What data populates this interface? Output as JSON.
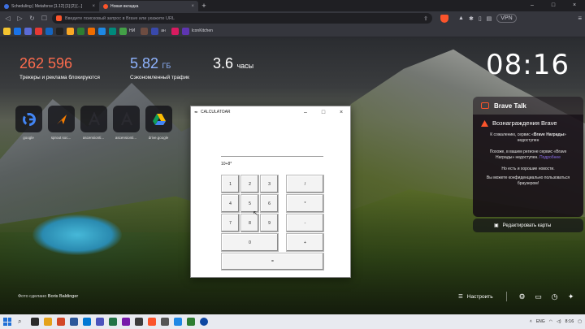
{
  "browser": {
    "tabs": [
      {
        "title": "Scheduling | Metaforce [1.12] [1] [2] [...]",
        "active": false
      },
      {
        "title": "Новая вкладка",
        "active": true
      }
    ],
    "new_tab_symbol": "+",
    "address_placeholder": "Введите поисковый запрос в Brave или укажите URL",
    "vpn_label": "VPN",
    "bookmarks": [
      {
        "label": "",
        "color": "#f4c430"
      },
      {
        "label": "",
        "color": "#1a73e8"
      },
      {
        "label": "",
        "color": "#5b6bd6"
      },
      {
        "label": "",
        "color": "#e53935"
      },
      {
        "label": "",
        "color": "#1565c0"
      },
      {
        "label": "",
        "color": "#212121"
      },
      {
        "label": "",
        "color": "#f9a825"
      },
      {
        "label": "",
        "color": "#2e7d32"
      },
      {
        "label": "",
        "color": "#ef6c00"
      },
      {
        "label": "",
        "color": "#1e88e5"
      },
      {
        "label": "",
        "color": "#00897b"
      },
      {
        "label": "НИ",
        "color": "#43a047"
      },
      {
        "label": "",
        "color": "#6d4c41"
      },
      {
        "label": "ан",
        "color": "#3949ab"
      },
      {
        "label": "",
        "color": "#d81b60"
      },
      {
        "label": "IconKitchen",
        "color": "#5e35b1"
      }
    ]
  },
  "stats": [
    {
      "value": "262 596",
      "unit": "",
      "label": "Трекеры и реклама блокируются"
    },
    {
      "value": "5.82",
      "unit": "ГБ",
      "label": "Сэкономленный трафик"
    },
    {
      "value": "3.6",
      "unit": "часы",
      "label": ""
    }
  ],
  "top_sites": [
    {
      "label": "google",
      "icon": "google-g-icon"
    },
    {
      "label": "sprout soc...",
      "icon": "sprout-arrow-icon"
    },
    {
      "label": "ascensionti...",
      "icon": "letter-a-icon"
    },
    {
      "label": "ascensionti...",
      "icon": "letter-a-icon"
    },
    {
      "label": "drive.google",
      "icon": "google-drive-icon"
    }
  ],
  "clock": "08:16",
  "brave_talk": {
    "title": "Brave Talk"
  },
  "rewards": {
    "title": "Вознаграждения Brave",
    "p1_pre": "К сожалению, сервис «",
    "p1_bold": "Brave Награды",
    "p1_post": "» недоступен",
    "p2_pre": "Похоже, в вашем регионе сервис «Brave Награды» недоступен. ",
    "p2_link": "Подробнее",
    "p3": "Но есть и хорошие новости.",
    "p4": "Вы можете конфиденциально пользоваться браузером!"
  },
  "edit_cards_label": "Редактировать карты",
  "photo_credit": {
    "prefix": "Фото сделано",
    "author": "Boris Baldinger"
  },
  "customize_label": "Настроить",
  "calculator": {
    "title": "CALCULATOAR",
    "display": "10+8*",
    "keys": [
      {
        "label": "1"
      },
      {
        "label": "2"
      },
      {
        "label": "3"
      },
      {
        "label": "/"
      },
      {
        "label": "4"
      },
      {
        "label": "5"
      },
      {
        "label": "6"
      },
      {
        "label": "*"
      },
      {
        "label": "7"
      },
      {
        "label": "8"
      },
      {
        "label": "9"
      },
      {
        "label": "-"
      },
      {
        "label": "0"
      },
      {
        "label": "+"
      },
      {
        "label": "="
      }
    ]
  },
  "taskbar": {
    "language": "ENG",
    "time": "8:16"
  }
}
